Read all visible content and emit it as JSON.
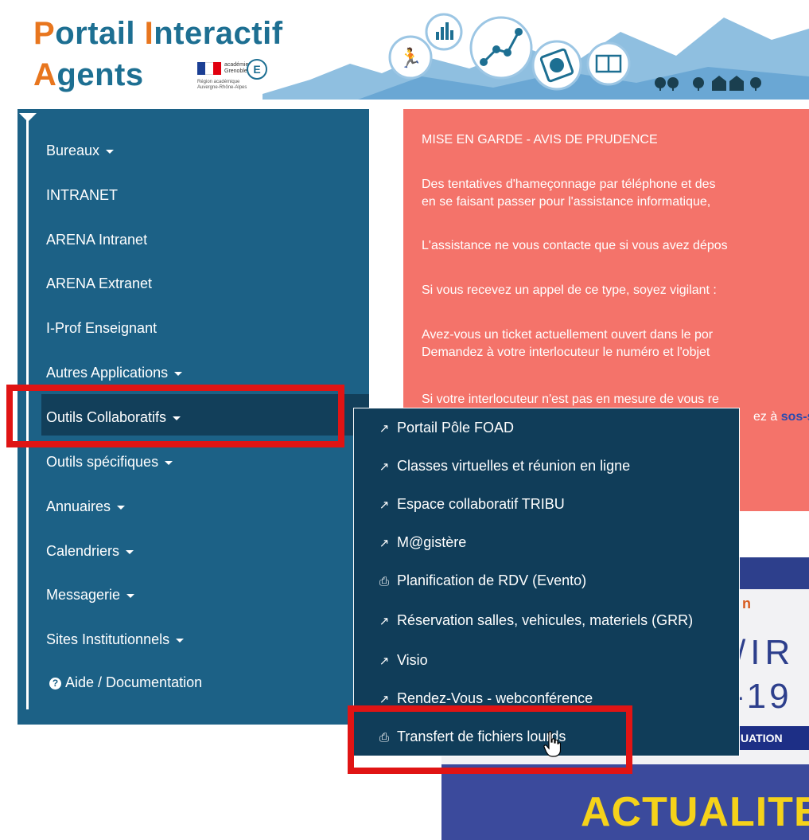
{
  "header": {
    "title_line1_hl1": "P",
    "title_line1_rest1": "ortail ",
    "title_line1_hl2": "I",
    "title_line1_rest2": "nteractif",
    "title_line2_hl": "A",
    "title_line2_rest": "gents",
    "academy_logo": {
      "text": "académie Grenoble",
      "region": "Région académique Auvergne-Rhône-Alpes",
      "letter": "E"
    },
    "banner_icons": [
      "runner-icon",
      "bar-chart-icon",
      "network-icon",
      "tablet-chart-icon",
      "book-icon",
      "trees-icon",
      "houses-icon"
    ]
  },
  "sidebar": {
    "items": [
      {
        "label": "Bureaux",
        "dropdown": true
      },
      {
        "label": "INTRANET",
        "dropdown": false
      },
      {
        "label": "ARENA Intranet",
        "dropdown": false
      },
      {
        "label": "ARENA Extranet",
        "dropdown": false
      },
      {
        "label": "I-Prof Enseignant",
        "dropdown": false
      },
      {
        "label": "Autres Applications",
        "dropdown": true
      },
      {
        "label": "Outils Collaboratifs",
        "dropdown": true,
        "active": true
      },
      {
        "label": "Outils spécifiques",
        "dropdown": true
      },
      {
        "label": "Annuaires",
        "dropdown": true
      },
      {
        "label": "Calendriers",
        "dropdown": true
      },
      {
        "label": "Messagerie",
        "dropdown": true
      },
      {
        "label": "Sites Institutionnels",
        "dropdown": true
      }
    ],
    "help": {
      "icon": "question-circle-icon",
      "label": "Aide / Documentation"
    }
  },
  "warning": {
    "title": "MISE EN GARDE - AVIS DE PRUDENCE",
    "p1a": "Des tentatives d'hameçonnage par téléphone et des",
    "p1b": "en se faisant passer pour l'assistance informatique,",
    "p2": "L'assistance ne vous contacte que si vous avez dépos",
    "p3": "Si vous recevez un appel de ce type, soyez vigilant :",
    "p4a": "Avez-vous un ticket actuellement ouvert dans le por",
    "p4b": "Demandez à votre interlocuteur le numéro et l'objet",
    "p5a": "Si votre interlocuteur n'est pas en mesure de vous re",
    "p5b_pre": "ez à ",
    "p5b_link": "sos-s"
  },
  "dropdown": {
    "items": [
      {
        "icon": "external-link-icon",
        "label": "Portail Pôle FOAD"
      },
      {
        "icon": "external-link-icon",
        "label": "Classes virtuelles et réunion en ligne"
      },
      {
        "icon": "external-link-icon",
        "label": "Espace collaboratif TRIBU"
      },
      {
        "icon": "external-link-icon",
        "label": "M@gistère"
      },
      {
        "icon": "inbox-icon",
        "label": "Planification de RDV (Evento)"
      },
      {
        "icon": "external-link-icon",
        "label": "Réservation salles, vehicules, materiels (GRR)"
      },
      {
        "icon": "external-link-icon",
        "label": "Visio"
      },
      {
        "icon": "external-link-icon",
        "label": "Rendez-Vous - webconférence"
      },
      {
        "icon": "inbox-icon",
        "label": "Transfert de fichiers lourds"
      }
    ]
  },
  "poster": {
    "orange_text": "n",
    "line1": "/IR",
    "line2": "-19",
    "badge": "UATION",
    "headline": "ACTUALITES"
  },
  "colors": {
    "sidebar_bg": "#1c6186",
    "dropdown_bg": "#103d59",
    "warning_bg": "#f4736a",
    "highlight_red": "#e01414",
    "logo_blue": "#1d6f92",
    "logo_orange": "#e8761e"
  }
}
